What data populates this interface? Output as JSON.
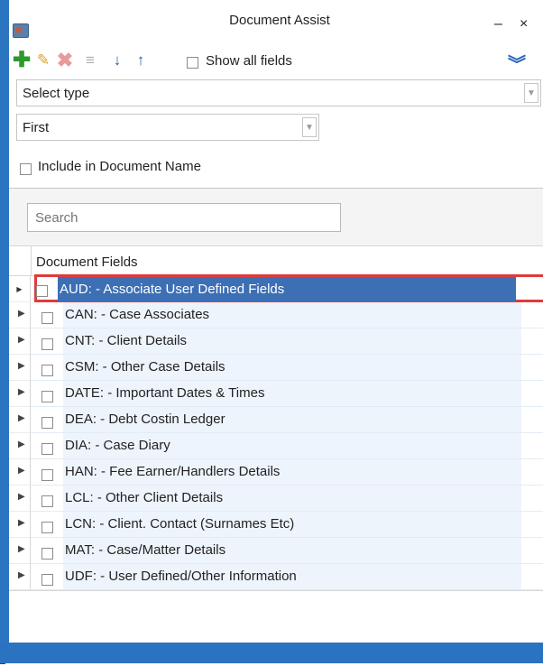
{
  "window": {
    "title": "Document Assist",
    "minimize_glyph": "–",
    "close_glyph": "×"
  },
  "toolbar": {
    "icons": [
      "add-icon",
      "edit-pencil-icon",
      "delete-icon",
      "list-icon",
      "move-down-icon",
      "move-up-icon",
      "collapse-chevron-icon"
    ],
    "show_all_label": "Show all fields",
    "show_all_checked": false
  },
  "type_select": {
    "value": "Select type"
  },
  "position_select": {
    "value": "First"
  },
  "include_in_name": {
    "label": "Include in Document Name",
    "checked": false
  },
  "search": {
    "placeholder": "Search"
  },
  "grid": {
    "header": "Document Fields",
    "rows": [
      {
        "label": "AUD:  - Associate User Defined Fields",
        "selected": true
      },
      {
        "label": "CAN:  - Case Associates",
        "selected": false
      },
      {
        "label": "CNT:  - Client Details",
        "selected": false
      },
      {
        "label": "CSM:  - Other Case Details",
        "selected": false
      },
      {
        "label": "DATE: - Important Dates & Times",
        "selected": false
      },
      {
        "label": "DEA:  - Debt Costin Ledger",
        "selected": false
      },
      {
        "label": "DIA:  - Case Diary",
        "selected": false
      },
      {
        "label": "HAN:  - Fee Earner/Handlers Details",
        "selected": false
      },
      {
        "label": "LCL:  - Other Client Details",
        "selected": false
      },
      {
        "label": "LCN:  - Client. Contact (Surnames Etc)",
        "selected": false
      },
      {
        "label": "MAT:  - Case/Matter Details",
        "selected": false
      },
      {
        "label": "UDF:  - User Defined/Other Information",
        "selected": false
      }
    ]
  },
  "colors": {
    "frame_blue": "#2b74c0",
    "selection_blue": "#3d6fb5",
    "highlight_red": "#e03b3b",
    "row_tint": "#eef4fc"
  }
}
